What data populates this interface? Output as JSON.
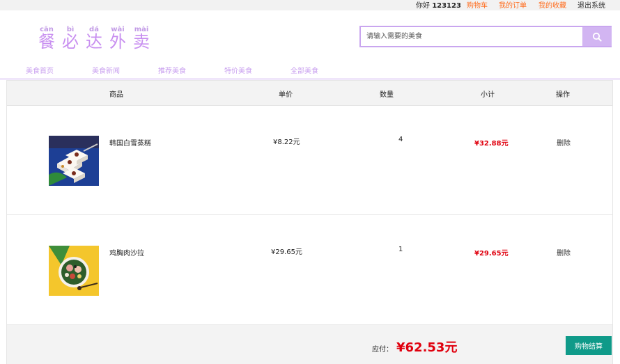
{
  "topbar": {
    "greeting": "你好",
    "username": "123123",
    "links": [
      {
        "label": "购物车",
        "color": "#ff6a1a"
      },
      {
        "label": "我的订单",
        "color": "#ff6a1a"
      },
      {
        "label": "我的收藏",
        "color": "#ff6a1a"
      },
      {
        "label": "退出系统",
        "color": "#333333"
      }
    ]
  },
  "logo": {
    "chars": [
      {
        "pinyin": "cān",
        "hanzi": "餐"
      },
      {
        "pinyin": "bì",
        "hanzi": "必"
      },
      {
        "pinyin": "dá",
        "hanzi": "达"
      },
      {
        "pinyin": "wài",
        "hanzi": "外"
      },
      {
        "pinyin": "mài",
        "hanzi": "卖"
      }
    ]
  },
  "search": {
    "placeholder": "请输入需要的美食",
    "icon": "search-icon"
  },
  "nav": [
    "美食首页",
    "美食新闻",
    "推荐美食",
    "特价美食",
    "全部美食"
  ],
  "table": {
    "headers": [
      "商品",
      "单价",
      "数量",
      "小计",
      "操作"
    ],
    "rows": [
      {
        "name": "韩国白雪蒸糕",
        "price": "¥8.22元",
        "qty": "4",
        "subtotal": "¥32.88元",
        "action": "删除"
      },
      {
        "name": "鸡胸肉沙拉",
        "price": "¥29.65元",
        "qty": "1",
        "subtotal": "¥29.65元",
        "action": "删除"
      }
    ]
  },
  "footer": {
    "pay_label": "应付：",
    "pay_amount": "¥62.53元",
    "checkout_label": "购物结算"
  },
  "colors": {
    "accent": "#c9a6ef",
    "price_red": "#e0000e",
    "checkout_green": "#0f9a89",
    "link_orange": "#ff6a1a"
  }
}
